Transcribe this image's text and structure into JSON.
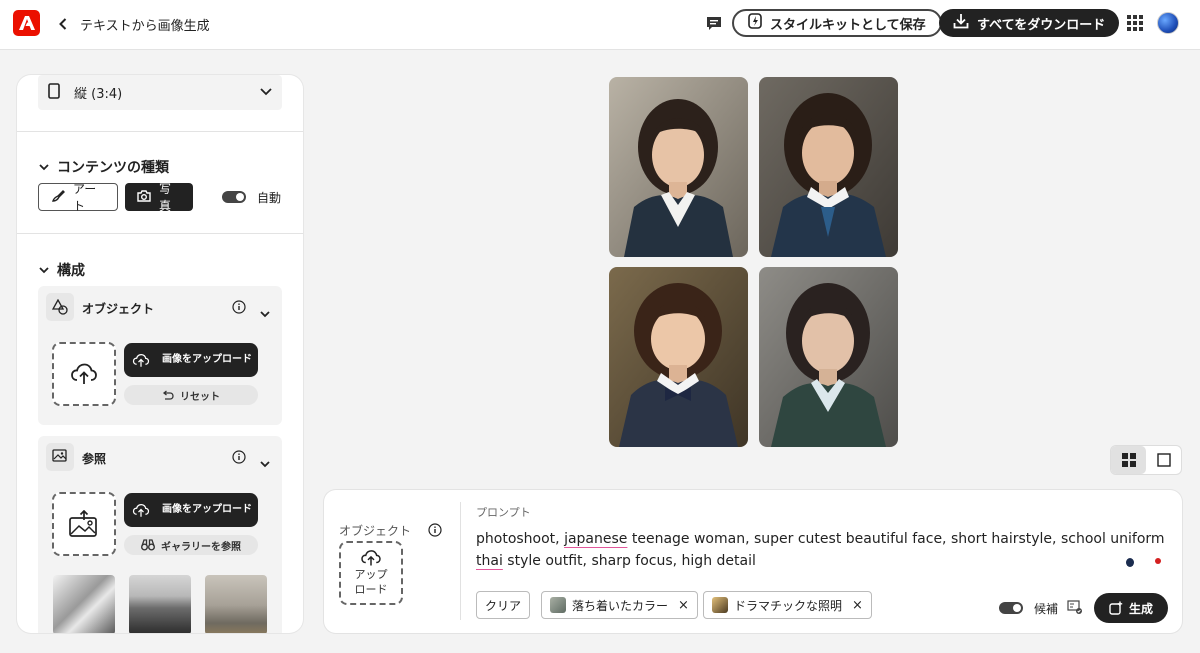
{
  "header": {
    "title": "テキストから画像生成",
    "save_style_kit": "スタイルキットとして保存",
    "download_all": "すべてをダウンロード"
  },
  "left_panel": {
    "aspect_ratio": "縦 (3:4)",
    "content_type": {
      "title": "コンテンツの種類",
      "art": "アート",
      "photo": "写真",
      "auto": "自動"
    },
    "composition": {
      "title": "構成",
      "object": {
        "title": "オブジェクト",
        "upload": "画像をアップロード",
        "reset": "リセット"
      },
      "reference": {
        "title": "参照",
        "upload": "画像をアップロード",
        "gallery": "ギャラリーを参照"
      }
    }
  },
  "prompt_panel": {
    "object_label": "オブジェクト",
    "upload_label": "アップ\nロード",
    "prompt_label": "プロンプト",
    "prompt_text_parts": [
      "photoshoot, ",
      "japanese",
      " teenage woman, super cutest beautiful face, short hairstyle, school uniform ",
      "thai",
      " style outfit, sharp focus, high detail"
    ],
    "clear": "クリア",
    "chips": [
      "落ち着いたカラー",
      "ドラマチックな照明"
    ],
    "suggestions": "候補",
    "generate": "生成"
  },
  "colors": {
    "brand_red": "#eb1000",
    "dark": "#222222",
    "spell_underline": "#e3579b"
  }
}
